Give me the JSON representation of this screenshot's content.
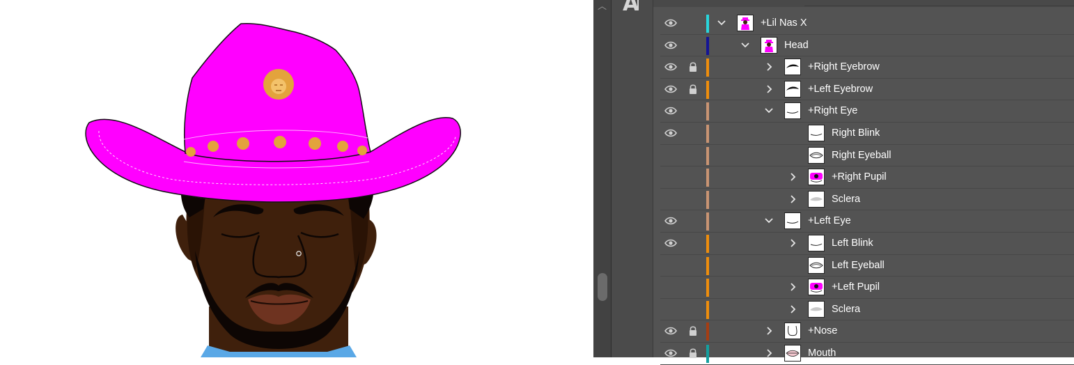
{
  "layers_panel": {
    "layers": [
      {
        "name": "+Lil Nas X",
        "visible": true,
        "locked": false,
        "color": "#28d6dc",
        "expanded": true,
        "depth": 0,
        "thumb": "figure"
      },
      {
        "name": "Head",
        "visible": true,
        "locked": false,
        "color": "#141496",
        "expanded": true,
        "depth": 1,
        "thumb": "figure"
      },
      {
        "name": "+Right Eyebrow",
        "visible": true,
        "locked": true,
        "color": "#ef8e0c",
        "expanded": false,
        "depth": 2,
        "thumb": "eyebrow"
      },
      {
        "name": "+Left Eyebrow",
        "visible": true,
        "locked": true,
        "color": "#ef8e0c",
        "expanded": false,
        "depth": 2,
        "thumb": "eyebrow"
      },
      {
        "name": "+Right Eye",
        "visible": true,
        "locked": false,
        "color": "#c99473",
        "expanded": true,
        "depth": 2,
        "thumb": "line"
      },
      {
        "name": "Right Blink",
        "visible": true,
        "locked": false,
        "color": "#c99473",
        "expanded": null,
        "depth": 3,
        "thumb": "line"
      },
      {
        "name": "Right Eyeball",
        "visible": false,
        "locked": false,
        "color": "#c99473",
        "expanded": null,
        "depth": 3,
        "thumb": "eyeball"
      },
      {
        "name": "+Right Pupil",
        "visible": false,
        "locked": false,
        "color": "#c99473",
        "expanded": false,
        "depth": 3,
        "thumb": "pupil"
      },
      {
        "name": "Sclera",
        "visible": false,
        "locked": false,
        "color": "#c99473",
        "expanded": false,
        "depth": 3,
        "thumb": "sclera"
      },
      {
        "name": "+Left Eye",
        "visible": true,
        "locked": false,
        "color": "#c99473",
        "expanded": true,
        "depth": 2,
        "thumb": "line"
      },
      {
        "name": "Left Blink",
        "visible": true,
        "locked": false,
        "color": "#ef8e0c",
        "expanded": false,
        "depth": 3,
        "thumb": "line"
      },
      {
        "name": "Left Eyeball",
        "visible": false,
        "locked": false,
        "color": "#ef8e0c",
        "expanded": null,
        "depth": 3,
        "thumb": "eyeball"
      },
      {
        "name": "+Left Pupil",
        "visible": false,
        "locked": false,
        "color": "#ef8e0c",
        "expanded": false,
        "depth": 3,
        "thumb": "pupil"
      },
      {
        "name": "Sclera",
        "visible": false,
        "locked": false,
        "color": "#ef8e0c",
        "expanded": false,
        "depth": 3,
        "thumb": "sclera"
      },
      {
        "name": "+Nose",
        "visible": true,
        "locked": true,
        "color": "#a63d12",
        "expanded": false,
        "depth": 2,
        "thumb": "nose"
      },
      {
        "name": "Mouth",
        "visible": true,
        "locked": true,
        "color": "#14a0a0",
        "expanded": false,
        "depth": 2,
        "thumb": "mouth"
      }
    ]
  },
  "colors": {
    "hat": "#ff00ff",
    "hat_shadow": "#c800c8",
    "emblem": "#e3a33c",
    "skin": "#3f200c",
    "skin_shade": "#2a1305",
    "lips": "#6e3320",
    "hair": "#0d0604",
    "collar": "#5aa8e6",
    "panel_bg": "#535353",
    "panel_text": "#ffffff"
  }
}
